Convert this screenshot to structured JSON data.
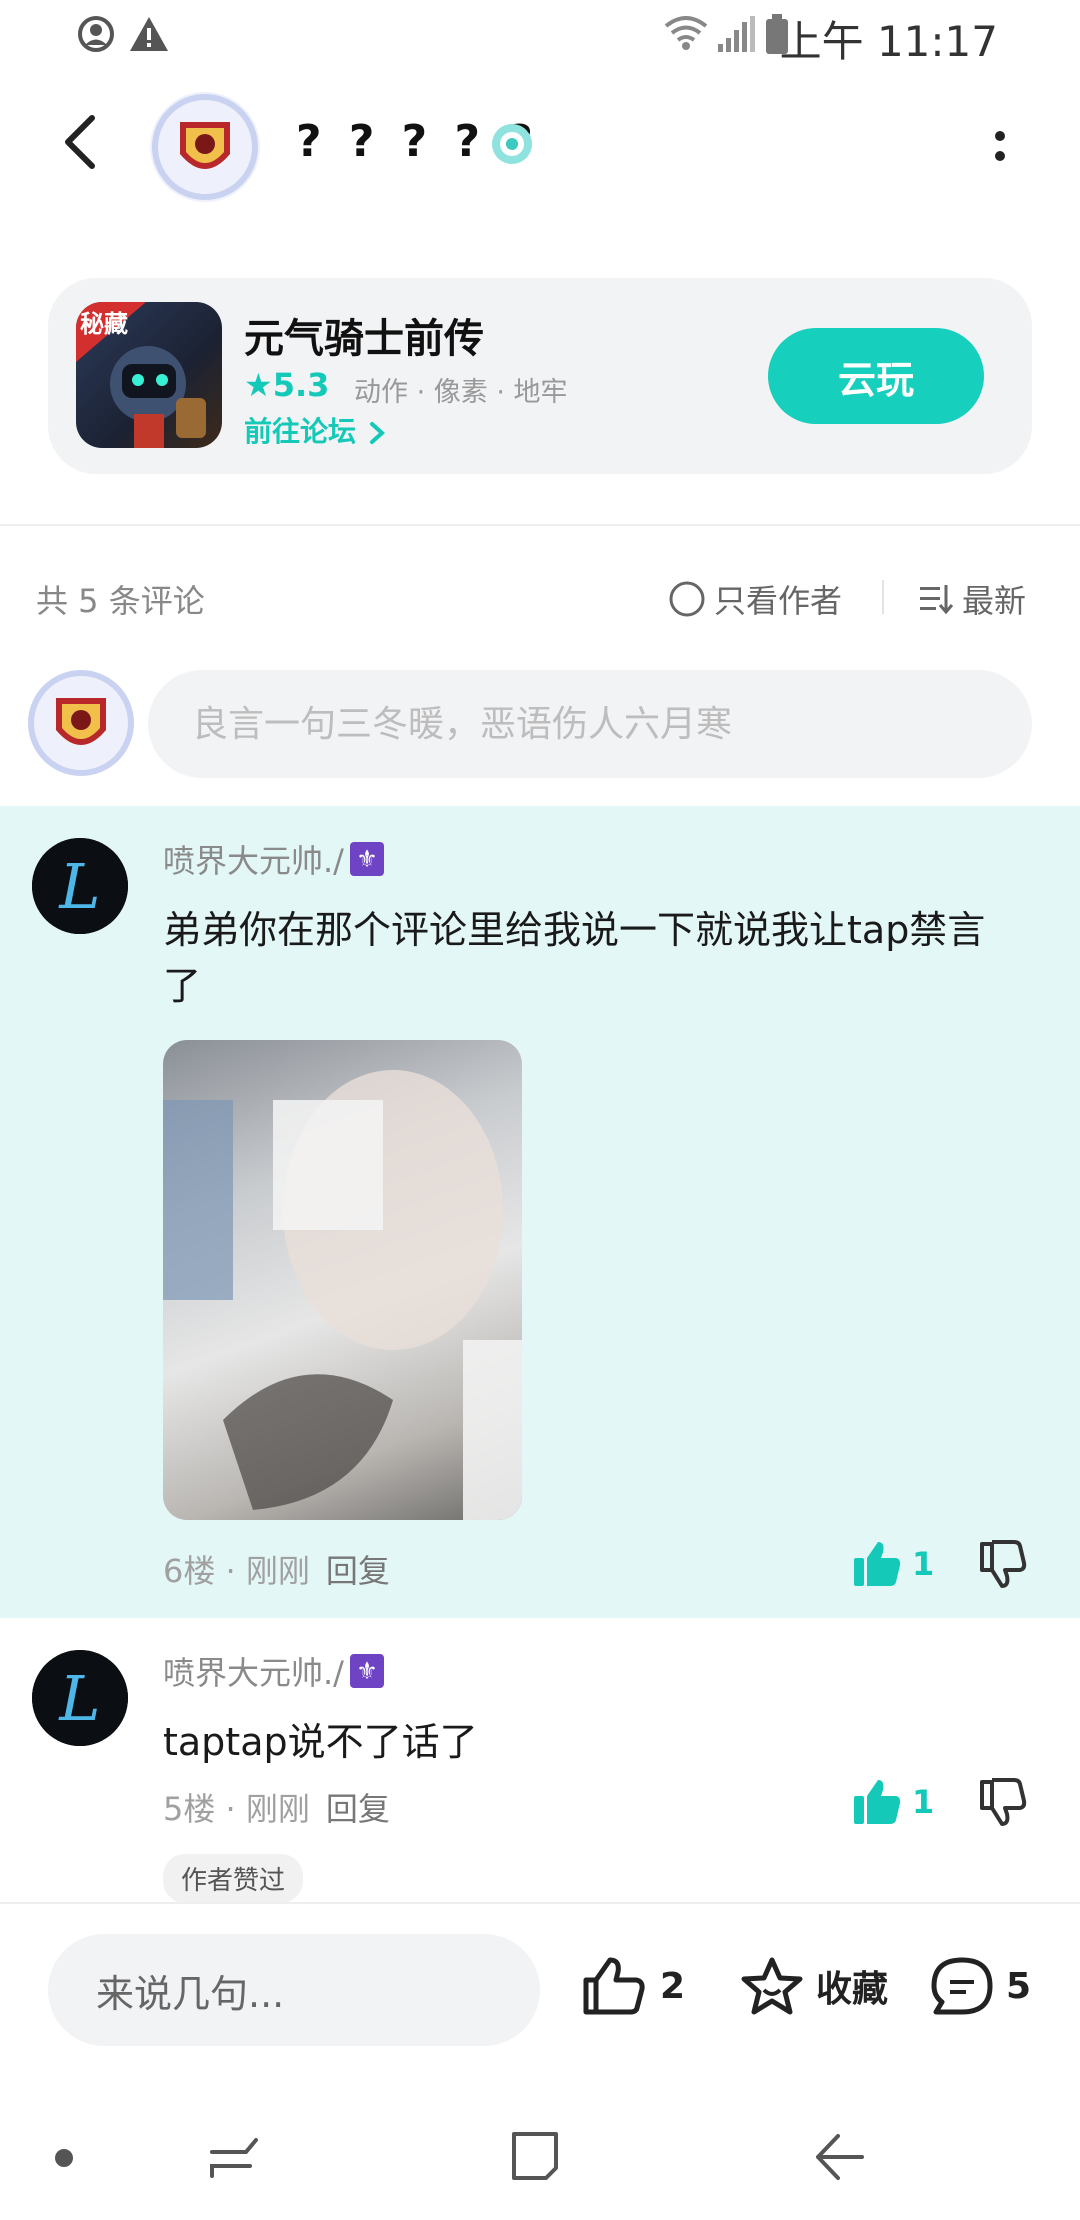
{
  "status_bar": {
    "time": "上午 11:17"
  },
  "header": {
    "title": "? ? ? ? ?"
  },
  "game": {
    "name": "元气骑士前传",
    "rating": "5.3",
    "tags": "动作 · 像素 · 地牢",
    "link_label": "前往论坛",
    "play_label": "云玩",
    "icon_badge": "秘藏"
  },
  "comments_header": {
    "count_label": "共 5 条评论",
    "author_only_label": "只看作者",
    "sort_label": "最新"
  },
  "comment_input": {
    "placeholder": "良言一句三冬暖，恶语伤人六月寒"
  },
  "comments": [
    {
      "author": "喷界大元帅./",
      "text": "弟弟你在那个评论里给我说一下就说我让tap禁言了",
      "floor": "6楼",
      "time": "刚刚",
      "reply_label": "回复",
      "likes": "1"
    },
    {
      "author": "喷界大元帅./",
      "text": "taptap说不了话了",
      "floor": "5楼",
      "time": "刚刚",
      "reply_label": "回复",
      "likes": "1",
      "badge": "作者赞过"
    }
  ],
  "bottom_bar": {
    "say_placeholder": "来说几句...",
    "likes": "2",
    "favorite_label": "收藏",
    "comments": "5"
  },
  "colors": {
    "accent": "#17cfbd",
    "highlight_bg": "#e3f7f6"
  }
}
